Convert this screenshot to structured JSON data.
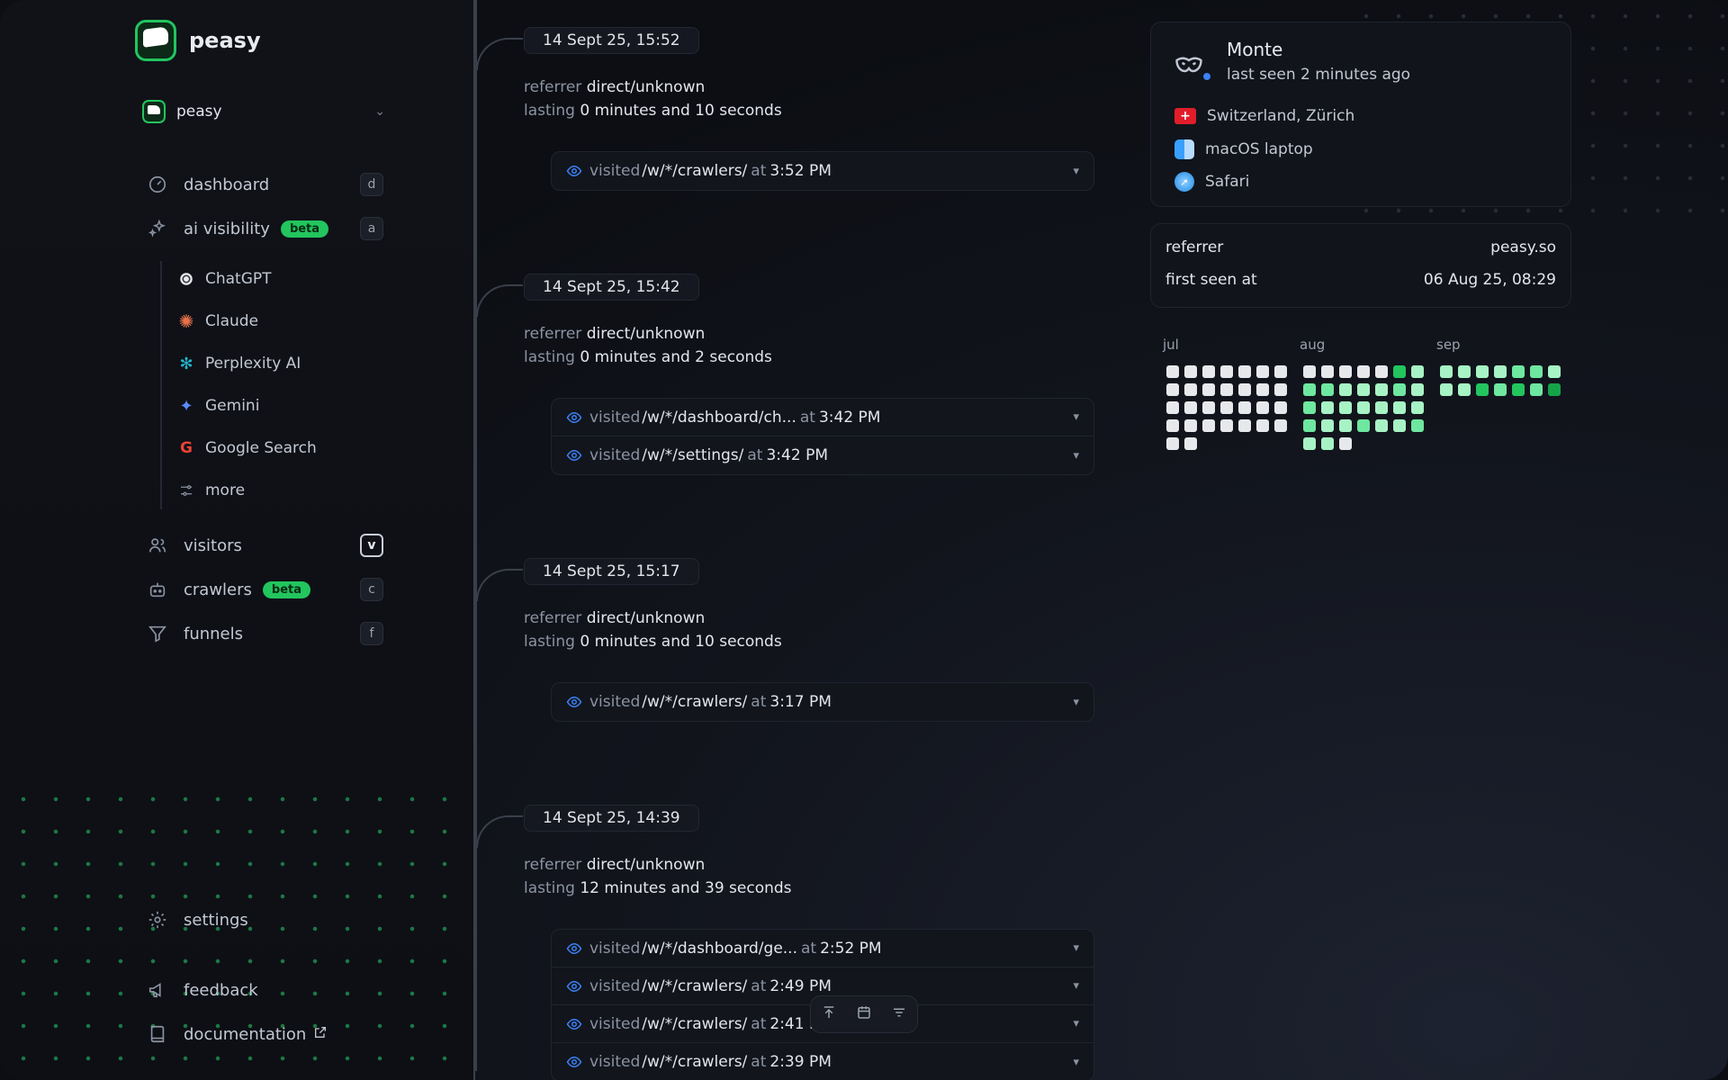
{
  "brand": {
    "name": "peasy"
  },
  "project": {
    "name": "peasy"
  },
  "nav": {
    "dashboard": {
      "label": "dashboard",
      "key": "d"
    },
    "ai_visibility": {
      "label": "ai visibility",
      "badge": "beta",
      "key": "a"
    },
    "ai_sub": [
      "ChatGPT",
      "Claude",
      "Perplexity AI",
      "Gemini",
      "Google Search",
      "more"
    ],
    "visitors": {
      "label": "visitors",
      "key": "v"
    },
    "crawlers": {
      "label": "crawlers",
      "badge": "beta",
      "key": "c"
    },
    "funnels": {
      "label": "funnels",
      "key": "f"
    },
    "settings": {
      "label": "settings"
    },
    "feedback": {
      "label": "feedback"
    },
    "documentation": {
      "label": "documentation"
    }
  },
  "labels": {
    "referrer": "referrer",
    "lasting": "lasting",
    "visited": "visited",
    "at": "at"
  },
  "sessions": [
    {
      "date": "14 Sept 25, 15:52",
      "referrer": "direct/unknown",
      "duration": "0 minutes and 10 seconds",
      "visits": [
        {
          "path": "/w/*/crawlers/",
          "time": "3:52 PM"
        }
      ]
    },
    {
      "date": "14 Sept 25, 15:42",
      "referrer": "direct/unknown",
      "duration": "0 minutes and 2 seconds",
      "visits": [
        {
          "path": "/w/*/dashboard/ch...",
          "time": "3:42 PM"
        },
        {
          "path": "/w/*/settings/",
          "time": "3:42 PM"
        }
      ]
    },
    {
      "date": "14 Sept 25, 15:17",
      "referrer": "direct/unknown",
      "duration": "0 minutes and 10 seconds",
      "visits": [
        {
          "path": "/w/*/crawlers/",
          "time": "3:17 PM"
        }
      ]
    },
    {
      "date": "14 Sept 25, 14:39",
      "referrer": "direct/unknown",
      "duration": "12 minutes and 39 seconds",
      "visits": [
        {
          "path": "/w/*/dashboard/ge...",
          "time": "2:52 PM"
        },
        {
          "path": "/w/*/crawlers/",
          "time": "2:49 PM"
        },
        {
          "path": "/w/*/crawlers/",
          "time": "2:41 PM"
        },
        {
          "path": "/w/*/crawlers/",
          "time": "2:39 PM"
        }
      ]
    }
  ],
  "visitor": {
    "name": "Monte",
    "last_seen": "last seen 2 minutes ago",
    "location": "Switzerland, Zürich",
    "device": "macOS laptop",
    "browser": "Safari",
    "referrer_label": "referrer",
    "referrer_value": "peasy.so",
    "first_seen_label": "first seen at",
    "first_seen_value": "06 Aug 25, 08:29"
  },
  "activity": {
    "months": [
      "jul",
      "aug",
      "sep"
    ],
    "jul": [
      0,
      0,
      0,
      0,
      0,
      0,
      0,
      0,
      0,
      0,
      0,
      0,
      0,
      0,
      0,
      0,
      0,
      0,
      0,
      0,
      0,
      0,
      0,
      0,
      0,
      0,
      0,
      0,
      0,
      0
    ],
    "aug": [
      0,
      0,
      0,
      0,
      0,
      3,
      1,
      2,
      2,
      1,
      1,
      1,
      2,
      1,
      2,
      1,
      1,
      1,
      1,
      1,
      1,
      2,
      1,
      1,
      2,
      1,
      1,
      2,
      1,
      1,
      0
    ],
    "sep": [
      1,
      1,
      1,
      1,
      2,
      2,
      1,
      1,
      1,
      3,
      2,
      3,
      2,
      4
    ]
  },
  "colors": {
    "accent_green": "#22c55e",
    "link_blue": "#3b82f6"
  }
}
